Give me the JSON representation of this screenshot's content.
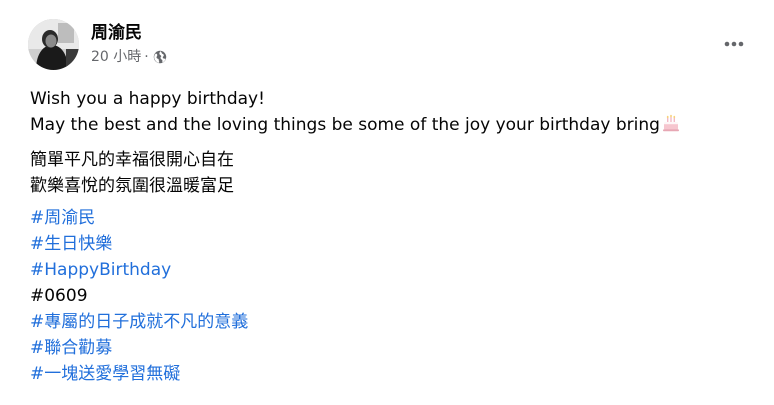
{
  "author": {
    "name": "周渝民"
  },
  "timestamp": "20 小時",
  "separator": "·",
  "privacy_icon": "globe-icon",
  "menu_icon": "more-options-icon",
  "post": {
    "paragraph1": [
      "Wish you a happy birthday!",
      "May the best and the loving things be some of the joy your birthday bring"
    ],
    "emoji": "birthday-cake-icon",
    "paragraph2": [
      "簡單平凡的幸福很開心自在",
      "歡樂喜悅的氛圍很溫暖富足"
    ],
    "hashtags": [
      "#周渝民",
      "#生日快樂",
      "#HappyBirthday"
    ],
    "plain_tag": "#0609",
    "hashtags2": [
      "#專屬的日子成就不凡的意義",
      "#聯合勸募",
      "#一塊送愛學習無礙"
    ]
  },
  "colors": {
    "link": "#216fdb",
    "meta": "#65676b",
    "text": "#050505"
  }
}
